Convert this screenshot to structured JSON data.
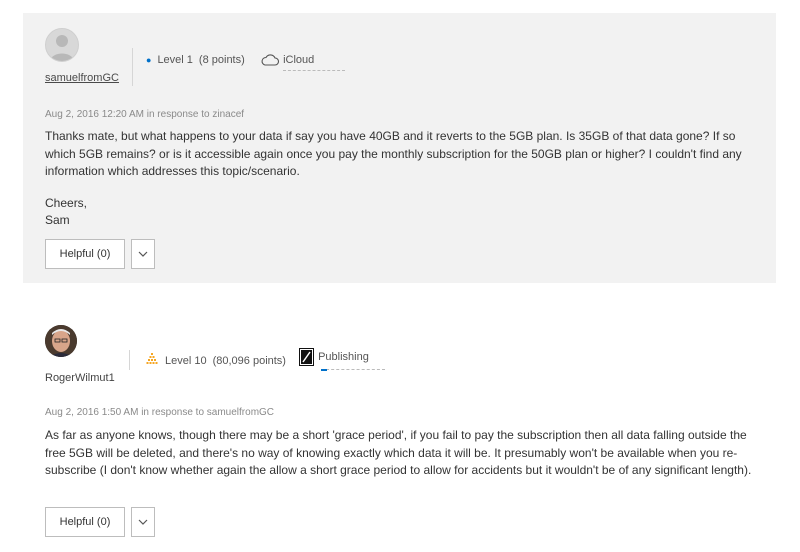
{
  "posts": [
    {
      "username": "samuelfromGC",
      "level": "Level 1",
      "points": "(8 points)",
      "community": "iCloud",
      "community_icon": "cloud-icon",
      "date": "Aug 2, 2016 12:20 AM",
      "in_response_to": "in response to zinacef",
      "paragraphs": [
        "Thanks mate, but what happens to your data if say you have 40GB and it reverts to the 5GB plan. Is 35GB of that data gone? If so which 5GB remains? or is it accessible again once you pay the monthly subscription for the 50GB plan or higher? I couldn't find any information which addresses this topic/scenario.",
        "Cheers,",
        "Sam"
      ],
      "helpful_label": "Helpful (0)"
    },
    {
      "username": "RogerWilmut1",
      "level": "Level 10",
      "points": "(80,096 points)",
      "community": "Publishing",
      "community_icon": "publishing-icon",
      "date": "Aug 2, 2016 1:50 AM",
      "in_response_to": "in response to samuelfromGC",
      "paragraphs": [
        "As far as anyone knows, though there may be a short 'grace period', if you fail to pay the subscription then all data falling outside the free 5GB will be deleted, and there's no way of knowing exactly which data it will be. It presumably won't be available when you re-subscribe (I don't know whether again the allow a short grace period to allow for accidents but it wouldn't be of any significant length)."
      ],
      "helpful_label": "Helpful (0)"
    }
  ],
  "colors": {
    "accent": "#0070c9",
    "level_orange": "#f5a623",
    "post_bg": "#f2f2f2"
  }
}
